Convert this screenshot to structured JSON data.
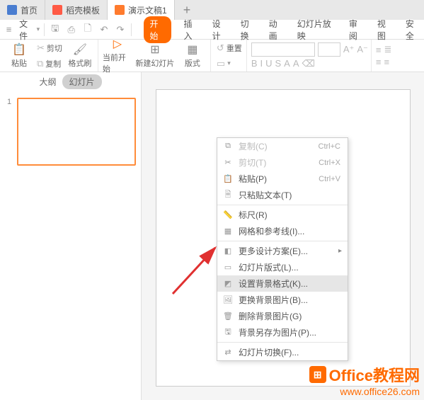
{
  "tabs": {
    "home": "首页",
    "template": "稻壳模板",
    "doc": "演示文稿1",
    "add": "+"
  },
  "menubar": {
    "file": "文件",
    "caret": "▾"
  },
  "ribbon_tabs": {
    "start": "开始",
    "insert": "插入",
    "design": "设计",
    "transition": "切换",
    "animation": "动画",
    "slideshow": "幻灯片放映",
    "review": "审阅",
    "view": "视图",
    "security": "安全"
  },
  "ribbon": {
    "paste": "粘贴",
    "cut": "剪切",
    "copy": "复制",
    "format_painter": "格式刷",
    "from_current": "当前开始",
    "new_slide": "新建幻灯片",
    "layout": "版式",
    "reset": "重置"
  },
  "panel": {
    "outline": "大纲",
    "slides": "幻灯片",
    "slide_num": "1"
  },
  "context_menu": {
    "copy": "复制(C)",
    "copy_sc": "Ctrl+C",
    "cut": "剪切(T)",
    "cut_sc": "Ctrl+X",
    "paste": "粘贴(P)",
    "paste_sc": "Ctrl+V",
    "paste_text": "只粘贴文本(T)",
    "ruler": "标尺(R)",
    "grid": "网格和参考线(I)...",
    "more_design": "更多设计方案(E)...",
    "slide_layout": "幻灯片版式(L)...",
    "bg_format": "设置背景格式(K)...",
    "change_bg": "更换背景图片(B)...",
    "delete_bg": "删除背景图片(G)",
    "save_bg": "背景另存为图片(P)...",
    "transition": "幻灯片切换(F)..."
  },
  "watermark": {
    "brand": "Office教程网",
    "url": "www.office26.com"
  }
}
